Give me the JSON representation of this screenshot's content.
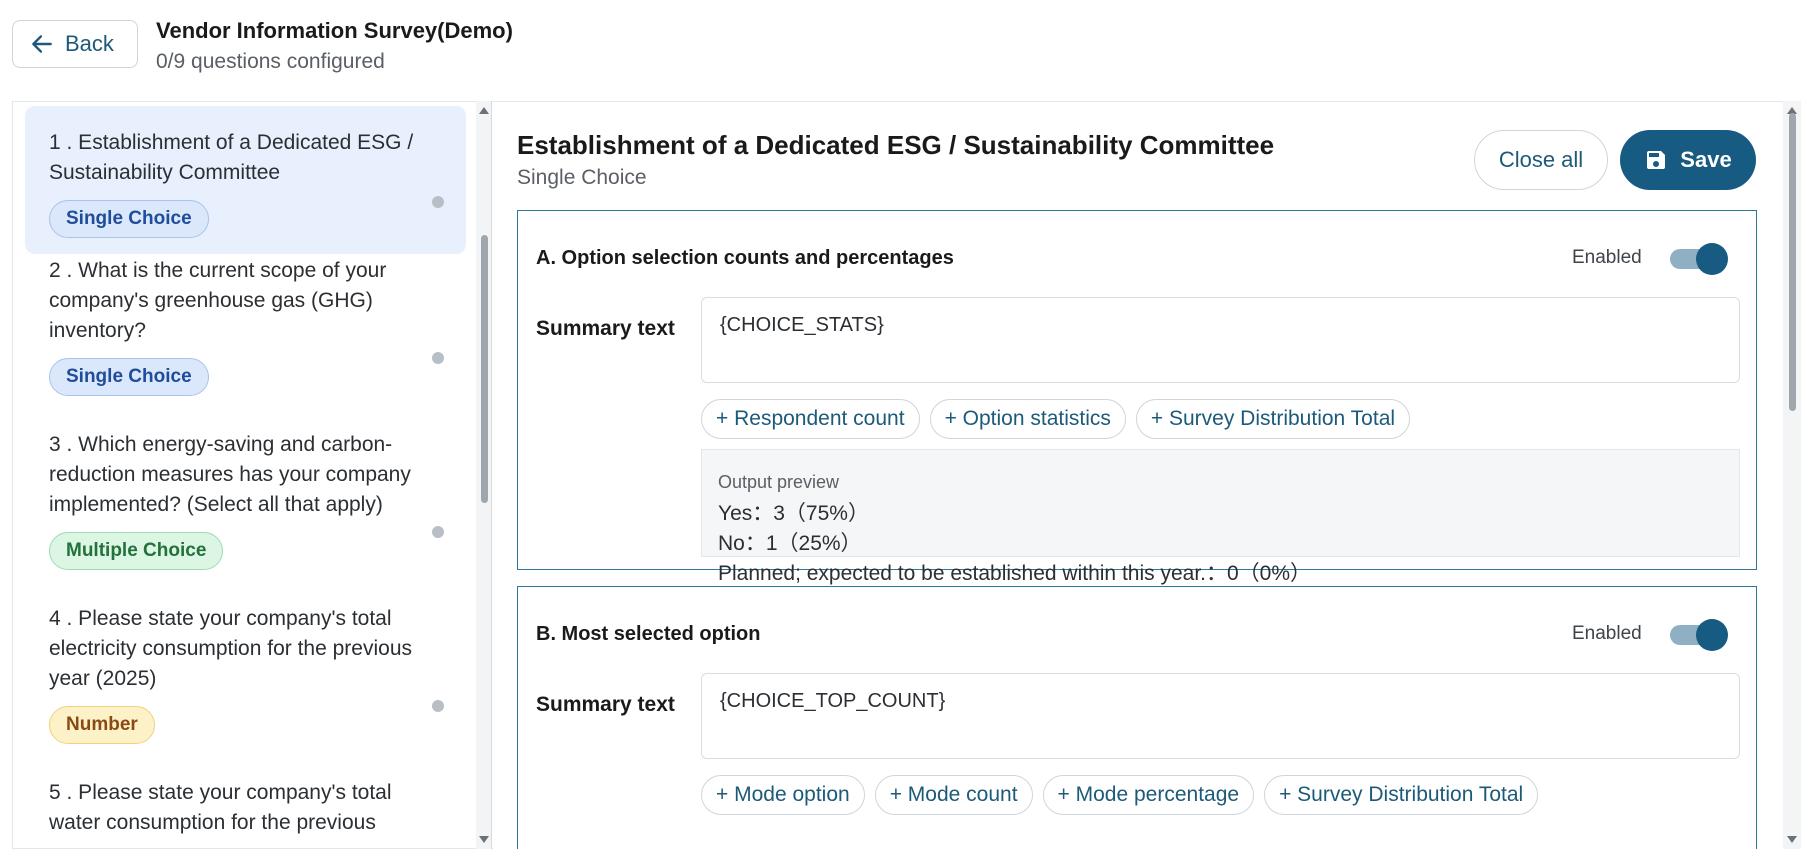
{
  "header": {
    "back_label": "Back",
    "survey_title": "Vendor Information Survey(Demo)",
    "progress_text": "0/9 questions configured"
  },
  "questions": [
    {
      "label": "1 . Establishment of a Dedicated ESG / Sustainability Committee",
      "type": "Single Choice"
    },
    {
      "label": "2 . What is the current scope of your company's greenhouse gas (GHG) inventory?",
      "type": "Single Choice"
    },
    {
      "label": "3 . Which energy-saving and carbon-reduction measures has your company implemented? (Select all that apply)",
      "type": "Multiple Choice"
    },
    {
      "label": "4 . Please state your company's total electricity consumption for the previous year (2025)",
      "type": "Number"
    },
    {
      "label": "5 . Please state your company's total water consumption for the previous"
    }
  ],
  "detail": {
    "title": "Establishment of a Dedicated ESG / Sustainability Committee",
    "type": "Single Choice",
    "close_all_label": "Close all",
    "save_label": "Save",
    "sections": [
      {
        "title": "A. Option selection counts and percentages",
        "enabled_label": "Enabled",
        "enabled": true,
        "summary_label": "Summary text",
        "summary_value": "{CHOICE_STATS}",
        "chips": [
          "+ Respondent count",
          "+ Option statistics",
          "+ Survey Distribution Total"
        ],
        "preview_label": "Output preview",
        "preview_lines": [
          "Yes：3（75%）",
          "No：1（25%）",
          "Planned; expected to be established within this year.：0（0%）"
        ]
      },
      {
        "title": "B. Most selected option",
        "enabled_label": "Enabled",
        "enabled": true,
        "summary_label": "Summary text",
        "summary_value": "{CHOICE_TOP_COUNT}",
        "chips": [
          "+ Mode option",
          "+ Mode count",
          "+ Mode percentage",
          "+ Survey Distribution Total"
        ]
      }
    ]
  },
  "colors": {
    "primary": "#185b82",
    "link": "#1d5a7a",
    "active_item_bg": "#e8f0fe"
  }
}
